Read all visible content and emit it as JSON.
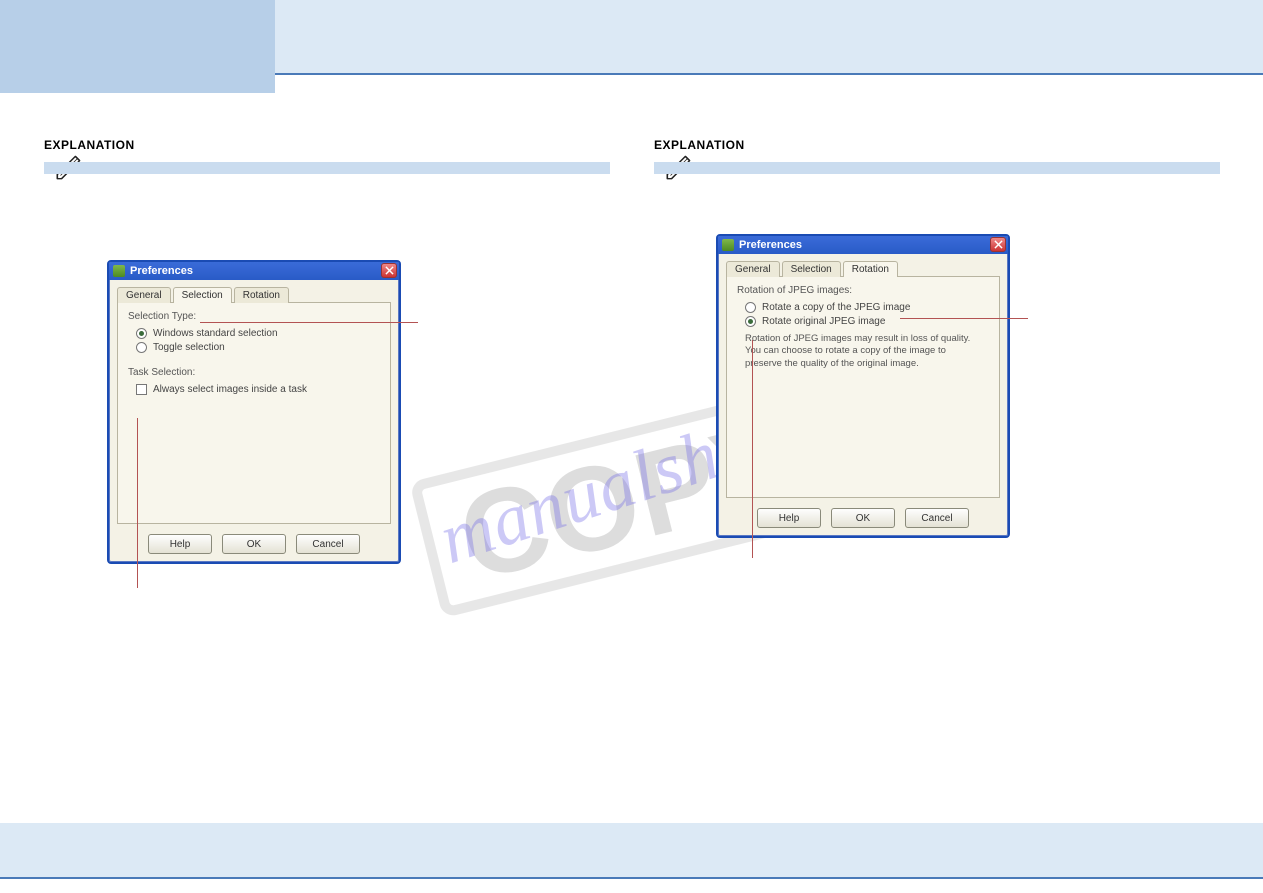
{
  "header_labels": {
    "left": "EXPLANATION",
    "right": "EXPLANATION"
  },
  "watermark_text": "manualshive.com",
  "stamp_text": "COPY",
  "dialog_left": {
    "title": "Preferences",
    "tabs": [
      "General",
      "Selection",
      "Rotation"
    ],
    "active_tab_index": 1,
    "group_selection_type": "Selection Type:",
    "radio_windows": "Windows standard selection",
    "radio_toggle": "Toggle selection",
    "group_task_selection": "Task Selection:",
    "check_always": "Always select images inside a task",
    "buttons": {
      "help": "Help",
      "ok": "OK",
      "cancel": "Cancel"
    }
  },
  "dialog_right": {
    "title": "Preferences",
    "tabs": [
      "General",
      "Selection",
      "Rotation"
    ],
    "active_tab_index": 2,
    "group_rotation": "Rotation of JPEG images:",
    "radio_copy": "Rotate a copy of the JPEG image",
    "radio_original": "Rotate original JPEG image",
    "note": "Rotation of JPEG images may result in loss of quality. You can choose to rotate a copy of the image to preserve the quality of the original image.",
    "buttons": {
      "help": "Help",
      "ok": "OK",
      "cancel": "Cancel"
    }
  }
}
